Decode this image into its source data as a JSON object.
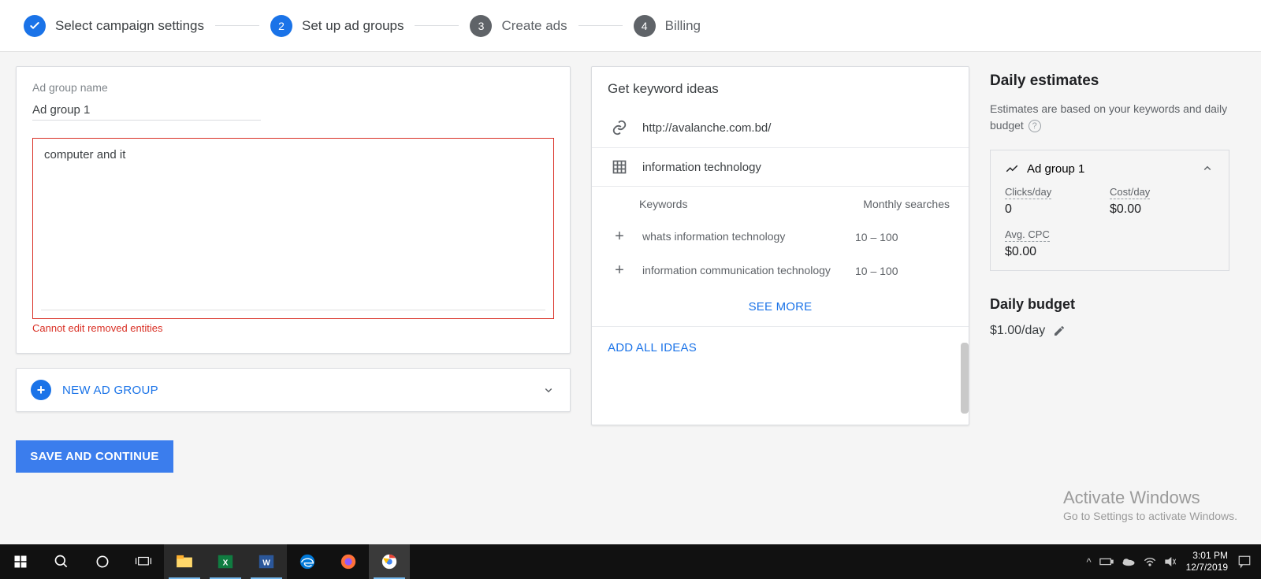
{
  "stepper": {
    "steps": [
      {
        "label": "Select campaign settings",
        "state": "done"
      },
      {
        "num": "2",
        "label": "Set up ad groups",
        "state": "active"
      },
      {
        "num": "3",
        "label": "Create ads",
        "state": "pending"
      },
      {
        "num": "4",
        "label": "Billing",
        "state": "pending"
      }
    ]
  },
  "adGroup": {
    "nameLabel": "Ad group name",
    "nameValue": "Ad group 1",
    "keywordsValue": "computer and it",
    "errorText": "Cannot edit removed entities"
  },
  "newGroupLabel": "NEW AD GROUP",
  "saveBtn": "SAVE AND CONTINUE",
  "ideas": {
    "title": "Get keyword ideas",
    "url": "http://avalanche.com.bd/",
    "category": "information technology",
    "headKeywords": "Keywords",
    "headSearches": "Monthly searches",
    "rows": [
      {
        "name": "whats information technology",
        "val": "10 – 100"
      },
      {
        "name": "information communication technology",
        "val": "10 – 100"
      }
    ],
    "seeMore": "SEE MORE",
    "addAll": "ADD ALL IDEAS"
  },
  "estimates": {
    "title": "Daily estimates",
    "sub": "Estimates are based on your keywords and daily budget",
    "groupName": "Ad group 1",
    "clicksLabel": "Clicks/day",
    "clicksVal": "0",
    "costLabel": "Cost/day",
    "costVal": "$0.00",
    "cpcLabel": "Avg. CPC",
    "cpcVal": "$0.00"
  },
  "budget": {
    "title": "Daily budget",
    "value": "$1.00/day"
  },
  "activate": {
    "t1": "Activate Windows",
    "t2": "Go to Settings to activate Windows."
  },
  "taskbar": {
    "time": "3:01 PM",
    "date": "12/7/2019"
  }
}
